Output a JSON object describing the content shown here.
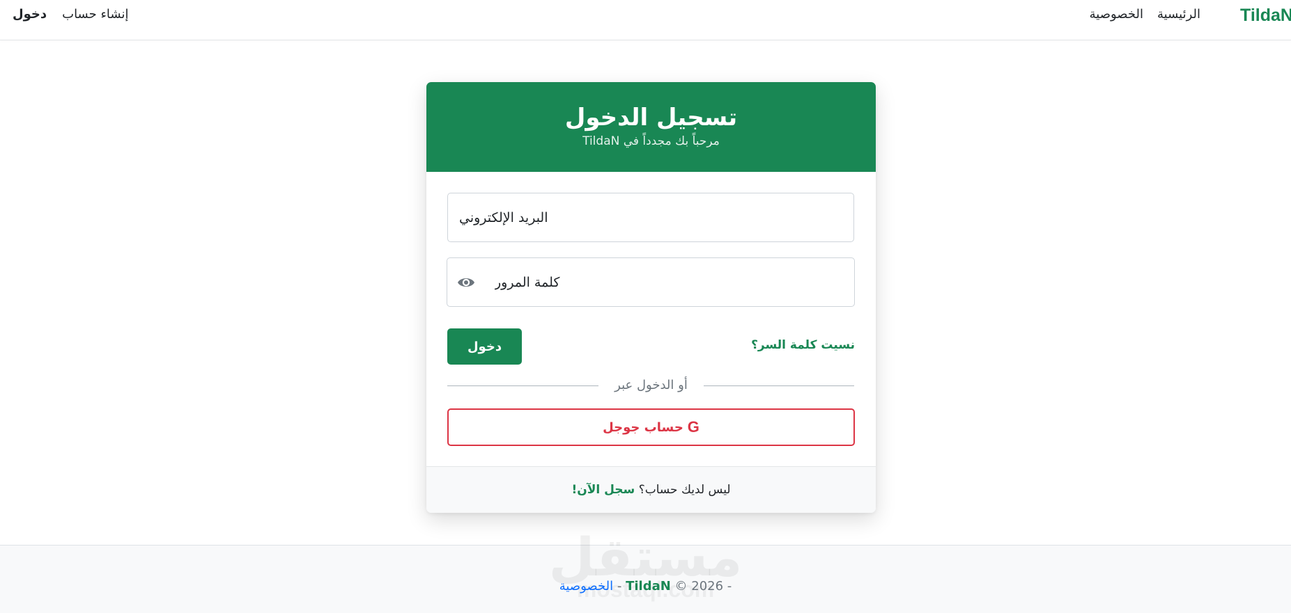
{
  "navbar": {
    "brand": "TildaN",
    "links": [
      "الرئيسية",
      "الخصوصية"
    ],
    "register_label": "إنشاء حساب",
    "login_label": "دخول"
  },
  "card": {
    "title": "تسجيل الدخول",
    "subtitle": "مرحباً بك مجدداً في TildaN",
    "email_placeholder": "البريد الإلكتروني",
    "password_placeholder": "كلمة المرور",
    "password_toggle_icon": "eye-icon",
    "forgot_password": "نسيت كلمة السر؟",
    "login_button": "دخول",
    "divider_text": "أو الدخول عبر",
    "google_icon": "G",
    "google_button": "حساب جوجل",
    "footer_text": "ليس لديك حساب؟",
    "signup_link": "سجل الآن!"
  },
  "footer": {
    "copyright": "© 2026 -",
    "brand": "TildaN",
    "separator": "-",
    "privacy_link": "الخصوصية",
    "watermark": "مستقل",
    "watermark_sub": "mostaql.com"
  },
  "colors": {
    "primary": "#198754",
    "danger": "#dc3545",
    "link": "#0d6efd",
    "muted": "#6c757d"
  }
}
